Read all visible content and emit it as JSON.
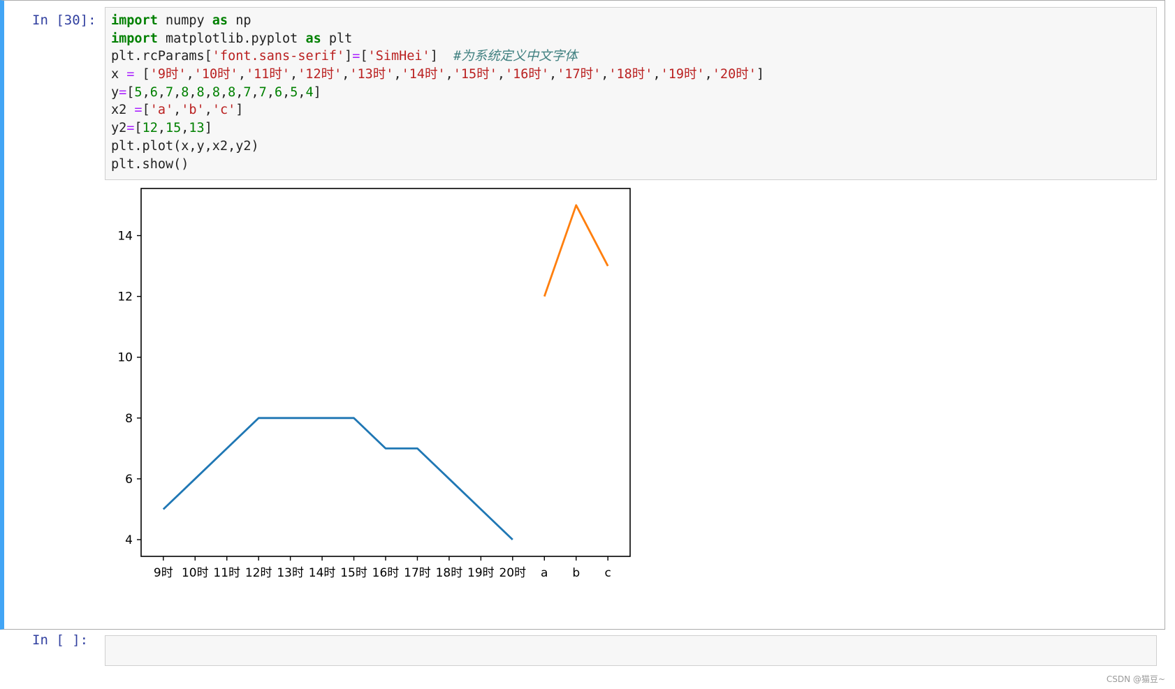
{
  "cell1": {
    "prompt": "In  [30]:",
    "code": [
      [
        {
          "t": "import",
          "c": "kw"
        },
        {
          "t": " numpy "
        },
        {
          "t": "as",
          "c": "kw"
        },
        {
          "t": " np"
        }
      ],
      [
        {
          "t": "import",
          "c": "kw"
        },
        {
          "t": " matplotlib.pyplot "
        },
        {
          "t": "as",
          "c": "kw"
        },
        {
          "t": " plt"
        }
      ],
      [
        {
          "t": "plt.rcParams["
        },
        {
          "t": "'font.sans-serif'",
          "c": "str"
        },
        {
          "t": "]"
        },
        {
          "t": "=",
          "c": "op"
        },
        {
          "t": "["
        },
        {
          "t": "'SimHei'",
          "c": "str"
        },
        {
          "t": "]  "
        },
        {
          "t": "#为系统定义中文字体",
          "c": "cmt"
        }
      ],
      [
        {
          "t": "x "
        },
        {
          "t": "=",
          "c": "op"
        },
        {
          "t": " ["
        },
        {
          "t": "'9时'",
          "c": "str"
        },
        {
          "t": ","
        },
        {
          "t": "'10时'",
          "c": "str"
        },
        {
          "t": ","
        },
        {
          "t": "'11时'",
          "c": "str"
        },
        {
          "t": ","
        },
        {
          "t": "'12时'",
          "c": "str"
        },
        {
          "t": ","
        },
        {
          "t": "'13时'",
          "c": "str"
        },
        {
          "t": ","
        },
        {
          "t": "'14时'",
          "c": "str"
        },
        {
          "t": ","
        },
        {
          "t": "'15时'",
          "c": "str"
        },
        {
          "t": ","
        },
        {
          "t": "'16时'",
          "c": "str"
        },
        {
          "t": ","
        },
        {
          "t": "'17时'",
          "c": "str"
        },
        {
          "t": ","
        },
        {
          "t": "'18时'",
          "c": "str"
        },
        {
          "t": ","
        },
        {
          "t": "'19时'",
          "c": "str"
        },
        {
          "t": ","
        },
        {
          "t": "'20时'",
          "c": "str"
        },
        {
          "t": "]"
        }
      ],
      [
        {
          "t": "y"
        },
        {
          "t": "=",
          "c": "op"
        },
        {
          "t": "["
        },
        {
          "t": "5",
          "c": "num"
        },
        {
          "t": ","
        },
        {
          "t": "6",
          "c": "num"
        },
        {
          "t": ","
        },
        {
          "t": "7",
          "c": "num"
        },
        {
          "t": ","
        },
        {
          "t": "8",
          "c": "num"
        },
        {
          "t": ","
        },
        {
          "t": "8",
          "c": "num"
        },
        {
          "t": ","
        },
        {
          "t": "8",
          "c": "num"
        },
        {
          "t": ","
        },
        {
          "t": "8",
          "c": "num"
        },
        {
          "t": ","
        },
        {
          "t": "7",
          "c": "num"
        },
        {
          "t": ","
        },
        {
          "t": "7",
          "c": "num"
        },
        {
          "t": ","
        },
        {
          "t": "6",
          "c": "num"
        },
        {
          "t": ","
        },
        {
          "t": "5",
          "c": "num"
        },
        {
          "t": ","
        },
        {
          "t": "4",
          "c": "num"
        },
        {
          "t": "]"
        }
      ],
      [
        {
          "t": "x2 "
        },
        {
          "t": "=",
          "c": "op"
        },
        {
          "t": "["
        },
        {
          "t": "'a'",
          "c": "str"
        },
        {
          "t": ","
        },
        {
          "t": "'b'",
          "c": "str"
        },
        {
          "t": ","
        },
        {
          "t": "'c'",
          "c": "str"
        },
        {
          "t": "]"
        }
      ],
      [
        {
          "t": "y2"
        },
        {
          "t": "=",
          "c": "op"
        },
        {
          "t": "["
        },
        {
          "t": "12",
          "c": "num"
        },
        {
          "t": ","
        },
        {
          "t": "15",
          "c": "num"
        },
        {
          "t": ","
        },
        {
          "t": "13",
          "c": "num"
        },
        {
          "t": "]"
        }
      ],
      [
        {
          "t": "plt.plot(x,y,x2,y2)"
        }
      ],
      [
        {
          "t": "plt.show()"
        }
      ]
    ]
  },
  "cell2": {
    "prompt": "In  [  ]:"
  },
  "watermark": "CSDN @猫豆~",
  "colors": {
    "series1": "#1f77b4",
    "series2": "#ff7f0e",
    "accent": "#42a5f5"
  },
  "chart_data": {
    "type": "line",
    "categories": [
      "9时",
      "10时",
      "11时",
      "12时",
      "13时",
      "14时",
      "15时",
      "16时",
      "17时",
      "18时",
      "19时",
      "20时",
      "a",
      "b",
      "c"
    ],
    "series": [
      {
        "x": [
          "9时",
          "10时",
          "11时",
          "12时",
          "13时",
          "14时",
          "15时",
          "16时",
          "17时",
          "18时",
          "19时",
          "20时"
        ],
        "values": [
          5,
          6,
          7,
          8,
          8,
          8,
          8,
          7,
          7,
          6,
          5,
          4
        ]
      },
      {
        "x": [
          "a",
          "b",
          "c"
        ],
        "values": [
          12,
          15,
          13
        ]
      }
    ],
    "yticks": [
      4,
      6,
      8,
      10,
      12,
      14
    ],
    "ylim": [
      3.45,
      15.55
    ],
    "title": "",
    "xlabel": "",
    "ylabel": "",
    "grid": false,
    "legend": "none"
  }
}
